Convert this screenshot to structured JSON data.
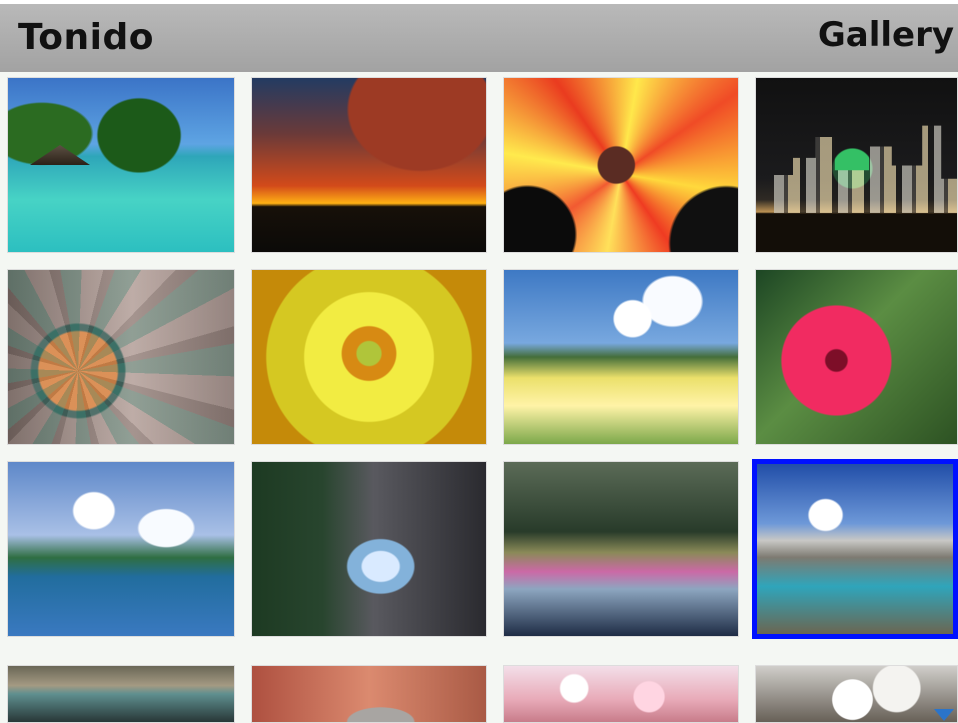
{
  "header": {
    "app_title": "Tonido",
    "section_title": "Gallery"
  },
  "gallery": {
    "rows": [
      [
        "beach-hut-photo",
        "sunset-photo",
        "tulip-photo",
        "night-city-photo"
      ],
      [
        "yarn-ball-photo",
        "yellow-flower-photo",
        "meadow-photo",
        "hibiscus-photo"
      ],
      [
        "coastline-photo",
        "waterfall-photo",
        "elk-lake-photo",
        "mountain-lake-photo"
      ],
      [
        "rocky-stream-photo",
        "pine-cone-photo",
        "cherry-blossom-photo",
        "white-flowers-photo"
      ]
    ],
    "selected_index": 11
  },
  "icons": {
    "scroll_indicator": "triangle-down"
  },
  "colors": {
    "title_bar": "#a9a9a9",
    "selection_border": "#0011ff"
  }
}
